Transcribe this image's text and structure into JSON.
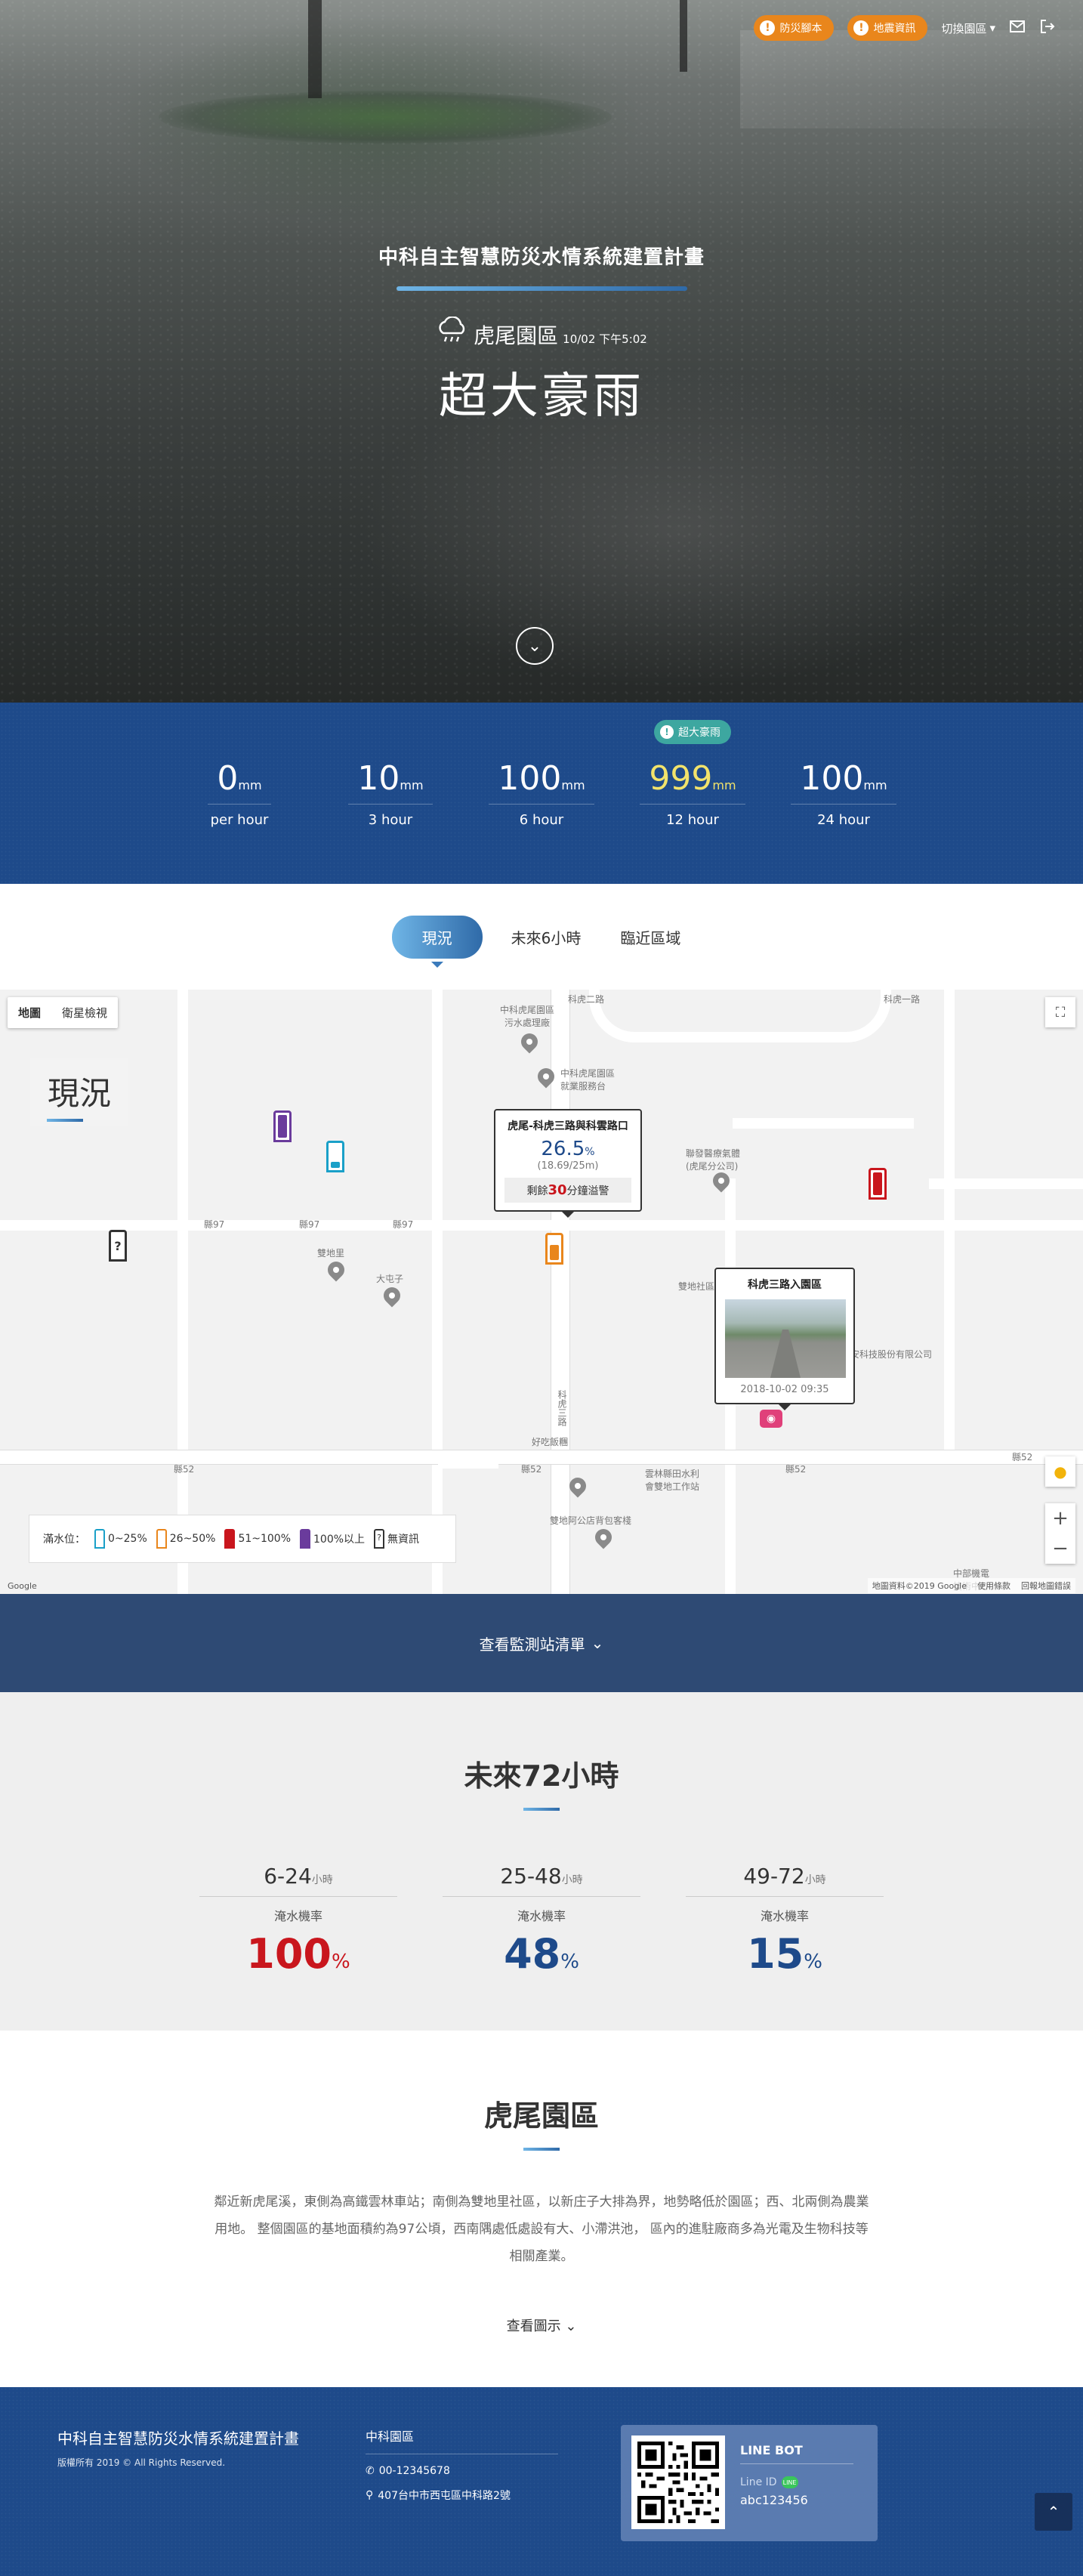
{
  "nav": {
    "drill_label": "防災腳本",
    "quake_label": "地震資訊",
    "switch_label": "切換園區",
    "switch_caret": "▾",
    "mail_icon": "mail-icon",
    "logout_icon": "logout-icon"
  },
  "hero": {
    "title": "中科自主智慧防災水情系統建置計畫",
    "location": "虎尾園區",
    "time": "10/02 下午5:02",
    "status": "超大豪雨",
    "weather_icon": "rain-cloud-icon"
  },
  "rainfall": [
    {
      "value": "0",
      "unit": "mm",
      "label": "per hour"
    },
    {
      "value": "10",
      "unit": "mm",
      "label": "3 hour"
    },
    {
      "value": "100",
      "unit": "mm",
      "label": "6 hour"
    },
    {
      "value": "999",
      "unit": "mm",
      "label": "12 hour",
      "badge": "超大豪雨"
    },
    {
      "value": "100",
      "unit": "mm",
      "label": "24 hour"
    }
  ],
  "tabs": [
    "現況",
    "未來6小時",
    "臨近區域"
  ],
  "map": {
    "type_map": "地圖",
    "type_satellite": "衛星檢視",
    "section_label": "現況",
    "roads": {
      "r1": "科虎二路",
      "r2": "科虎一路",
      "r3": "科虎三路",
      "r4": "科虎一路",
      "county1": "縣97",
      "county2": "縣97",
      "county3": "縣97",
      "county4": "縣97",
      "county5": "縣52",
      "county6": "縣52",
      "county7": "縣52",
      "county8": "縣52"
    },
    "places": {
      "sewage": "中科虎尾園區\n污水處理廠",
      "service": "中科虎尾園區\n就業服務台",
      "hospital": "聯發醫療氣體\n(虎尾分公司)",
      "land": "雙地里",
      "datun": "大屯子",
      "tech": "安科技股份有限公司",
      "station": "雲林縣田水利\n會雙地工作站",
      "haochi": "好吃飯糰",
      "shuangdi": "雙地阿公店背包客棧",
      "ditu": "雙地社區",
      "yunlin": "中部機電\n技術中心"
    },
    "popup1": {
      "title": "虎尾-科虎三路與科雲路口",
      "pct": "26.5",
      "pct_unit": "%",
      "sub": "(18.69/25m)",
      "note_pre": "剩餘",
      "note_num": "30",
      "note_post": "分鐘溢警"
    },
    "popup2": {
      "title": "科虎三路入園區",
      "time": "2018-10-02 09:35"
    },
    "legend": {
      "title": "滿水位：",
      "items": [
        "0~25%",
        "26~50%",
        "51~100%",
        "100%以上",
        "無資訊"
      ]
    },
    "footer_left": "Google",
    "footer_right": [
      "地圖資料©2019 Google",
      "使用條款",
      "回報地圖錯誤"
    ]
  },
  "station_bar": {
    "label": "查看監測站清單",
    "caret": "⌄"
  },
  "future": {
    "title": "未來72小時",
    "cells": [
      {
        "range": "6-24",
        "unit": "小時",
        "label": "淹水機率",
        "value": "100",
        "pct": "%"
      },
      {
        "range": "25-48",
        "unit": "小時",
        "label": "淹水機率",
        "value": "48",
        "pct": "%"
      },
      {
        "range": "49-72",
        "unit": "小時",
        "label": "淹水機率",
        "value": "15",
        "pct": "%"
      }
    ]
  },
  "park": {
    "title": "虎尾園區",
    "description": "鄰近新虎尾溪，東側為高鐵雲林車站；南側為雙地里社區，以新庄子大排為界，地勢略低於園區；西、北兩側為農業用地。 整個園區的基地面積約為97公頃，西南隅處低處設有大、小滯洪池， 區內的進駐廠商多為光電及生物科技等相關產業。",
    "more": "查看圖示"
  },
  "footer": {
    "title": "中科自主智慧防災水情系統建置計畫",
    "copyright": "版權所有 2019 © All Rights Reserved.",
    "org": "中科園區",
    "phone": "00-12345678",
    "address": "407台中市西屯區中科路2號",
    "line_title": "LINE BOT",
    "line_id_label": "Line ID",
    "line_id": "abc123456"
  },
  "colors": {
    "accent_orange": "#e9861c",
    "navy": "#1e4a8a",
    "alert_red": "#c9161d",
    "teal_badge": "#3da7a0"
  }
}
